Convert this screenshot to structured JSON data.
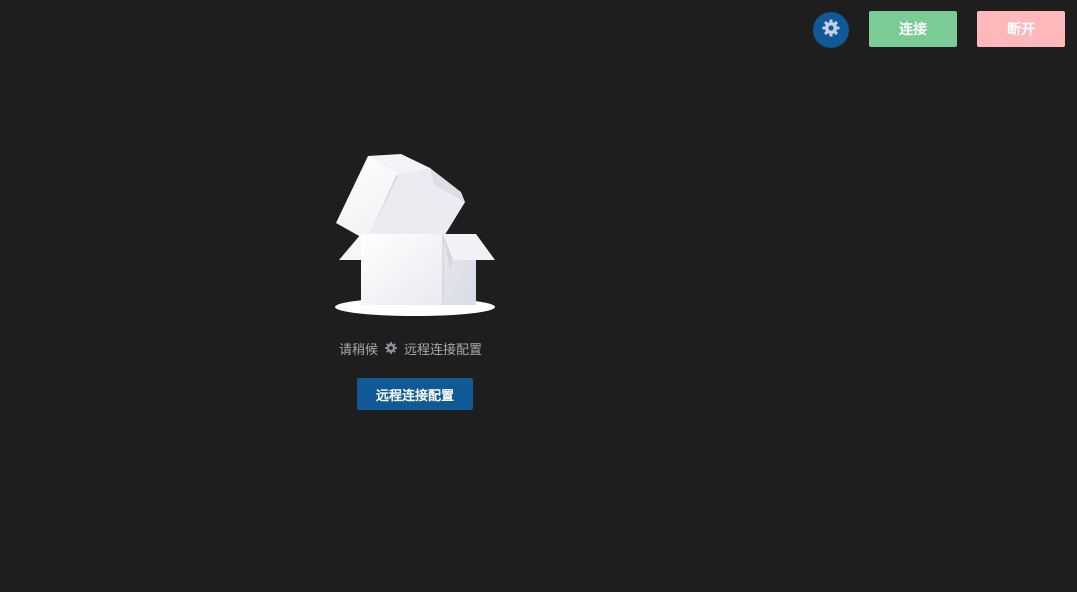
{
  "toolbar": {
    "settings_icon": "gear-icon",
    "connect_label": "连接",
    "disconnect_label": "断开"
  },
  "empty_state": {
    "illustration": "open-box-illustration",
    "wait_prefix": "请稍候",
    "wait_icon": "gear-icon",
    "wait_suffix": "远程连接配置",
    "button_label": "远程连接配置"
  },
  "colors": {
    "background": "#1e1e1e",
    "primary": "#0f5a96",
    "connect": "#7bcb97",
    "disconnect": "#feb8bc",
    "muted_text": "#a9a9a9"
  }
}
